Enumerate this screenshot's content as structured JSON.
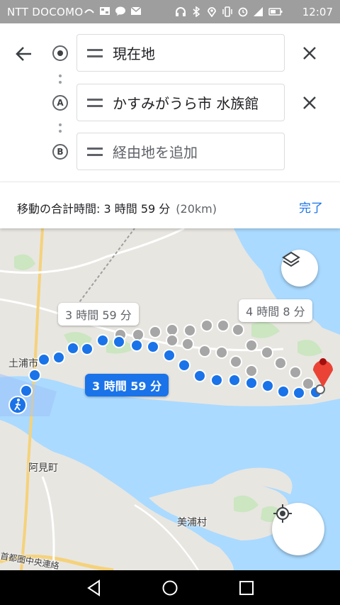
{
  "status_bar": {
    "carrier": "NTT DOCOMO",
    "time": "12:07",
    "left_icons": [
      "signal-app-icon",
      "image-icon",
      "chat-icon",
      "mail-icon"
    ],
    "right_icons": [
      "headset-icon",
      "bluetooth-icon",
      "location-icon",
      "vibrate-icon",
      "alarm-icon",
      "network-4g-icon",
      "battery-icon"
    ]
  },
  "route": {
    "origin": "現在地",
    "stop_a_marker": "A",
    "stop_a": "かすみがうら市 水族館",
    "stop_b_marker": "B",
    "stop_b_placeholder": "経由地を追加"
  },
  "summary": {
    "total_time": "移動の合計時間: 3 時間 59 分",
    "distance": "(20km)",
    "done_label": "完了"
  },
  "map": {
    "labels": {
      "city_tsuchiura": "土浦市",
      "town_ami": "阿見町",
      "village_miho": "美浦村",
      "road": "首都圏中央連絡"
    },
    "route_options": [
      {
        "time": "3 時間 59 分",
        "selected": true
      },
      {
        "time": "3 時間 59 分",
        "selected": false
      },
      {
        "time": "4 時間 8 分",
        "selected": false
      }
    ],
    "colors": {
      "water": "#aadaff",
      "land": "#e8e6e1",
      "route_primary": "#1a73e8",
      "route_alt": "#a6a6a6",
      "pin": "#ea4335"
    }
  }
}
